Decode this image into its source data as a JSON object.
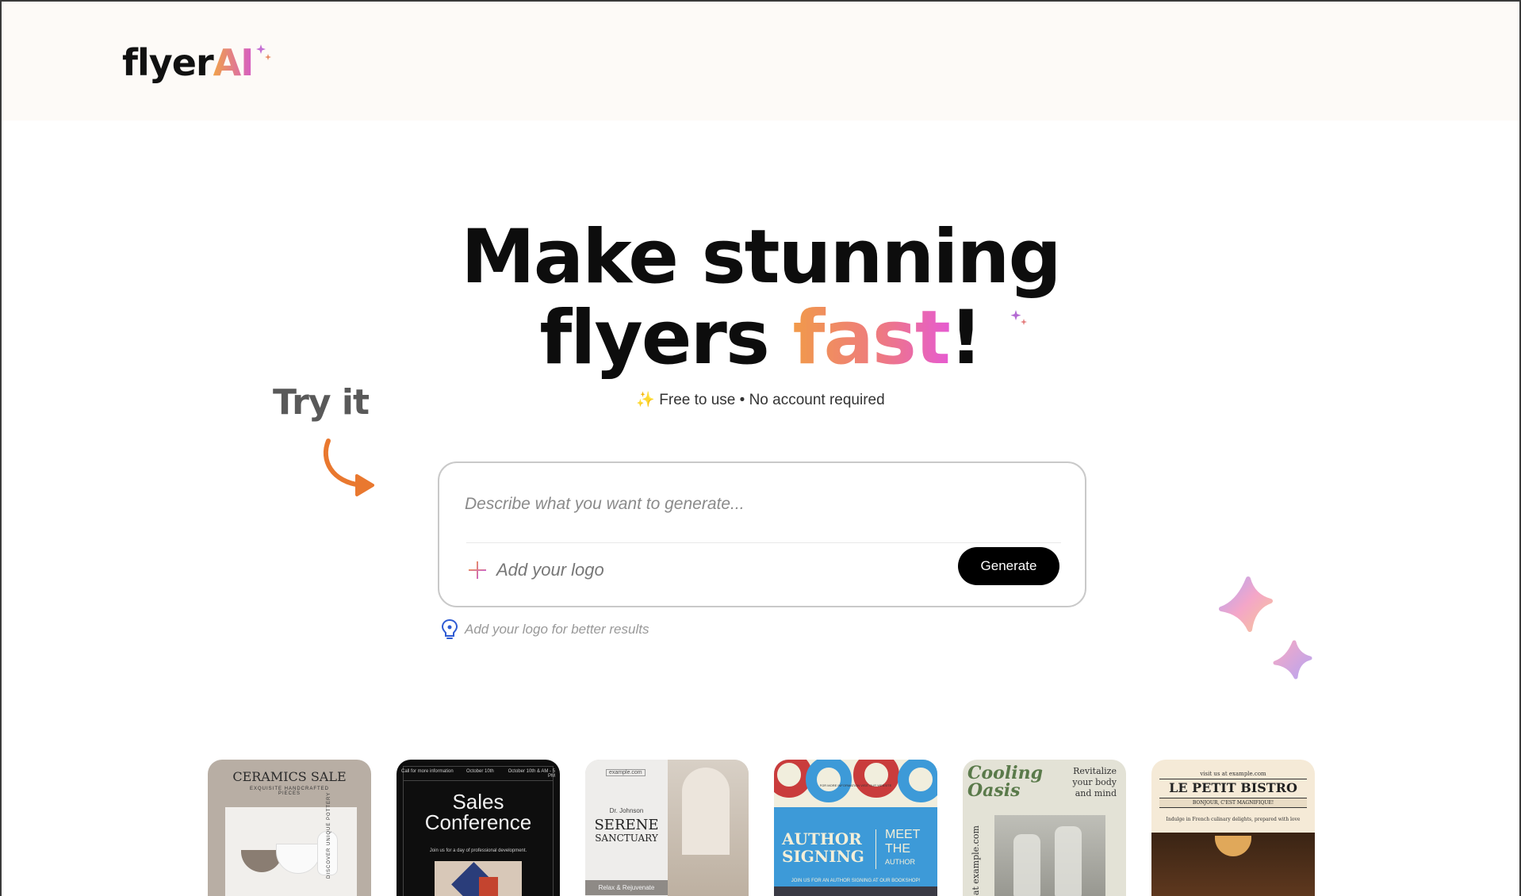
{
  "header": {
    "logo_text": "flyer",
    "logo_accent": "AI"
  },
  "hero": {
    "line1": "Make stunning",
    "line2_prefix": "flyers ",
    "line2_accent": "fast",
    "line2_suffix": "!",
    "subtitle_icon": "✨",
    "subtitle": "Free to use • No account required"
  },
  "try_it": "Try it",
  "prompt": {
    "placeholder": "Describe what you want to generate...",
    "add_logo_label": "Add your logo",
    "generate_label": "Generate",
    "hint": "Add your logo for better results"
  },
  "colors": {
    "accent_orange": "#e9782f",
    "gradient_start": "#f19a4a",
    "gradient_end": "#e65bd0",
    "button_bg": "#000000",
    "header_bg": "#fdfaf7"
  },
  "icons": {
    "hint": "lightbulb-icon",
    "add": "plus-icon",
    "sparkle": "sparkle-icon"
  },
  "gallery": [
    {
      "title": "CERAMICS SALE",
      "sub": "EXQUISITE HANDCRAFTED PIECES",
      "side": "DISCOVER UNIQUE POTTERY"
    },
    {
      "title_line1": "Sales",
      "title_line2": "Conference",
      "top_left": "Call for more information",
      "top_mid": "October 10th",
      "top_right": "October 10th & AM - 5 PM",
      "body": "Join us for a day of professional development."
    },
    {
      "url": "example.com",
      "name": "Dr. Johnson",
      "title_line1": "SERENE",
      "title_line2": "SANCTUARY",
      "footer": "Relax & Rejuvenate"
    },
    {
      "top": "FOR MORE INFORMATION VISIT OUR WEBSITE",
      "title_line1": "AUTHOR",
      "title_line2": "SIGNING",
      "meet": "MEET",
      "the": "THE",
      "author": "AUTHOR",
      "footer": "JOIN US FOR AN AUTHOR SIGNING AT OUR BOOKSHOP!"
    },
    {
      "title_line1": "Cooling",
      "title_line2": "Oasis",
      "right1": "Revitalize",
      "right2": "your body",
      "right3": "and mind",
      "side": "w at example.com"
    },
    {
      "top": "visit us at example.com",
      "title": "LE PETIT BISTRO",
      "sub": "BONJOUR, C'EST MAGNIFIQUE!",
      "body": "Indulge in French culinary delights, prepared with love"
    }
  ]
}
